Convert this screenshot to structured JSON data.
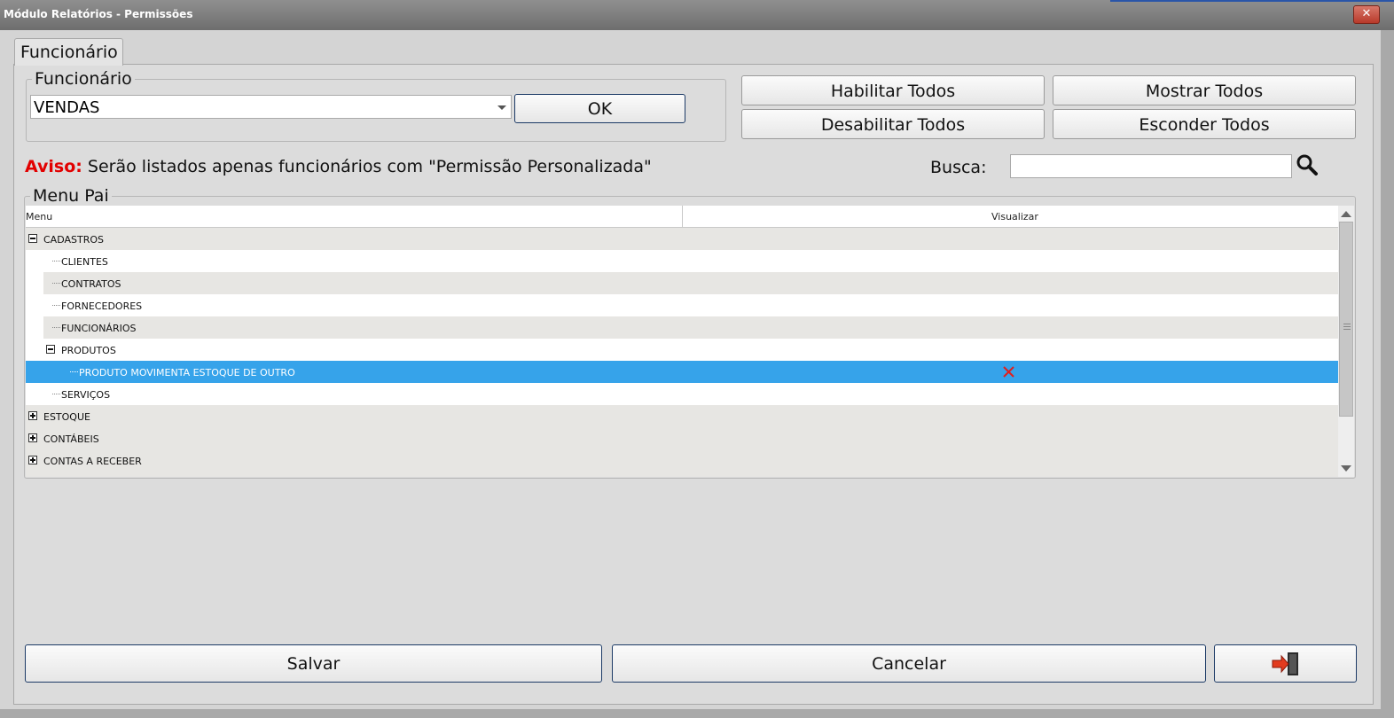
{
  "window": {
    "title": "Módulo Relatórios - Permissões",
    "close_label": "✕"
  },
  "tab": {
    "label": "Funcionário"
  },
  "funcionario": {
    "legend": "Funcionário",
    "selected": "VENDAS",
    "ok_label": "OK"
  },
  "actions": {
    "habilitar_todos": "Habilitar Todos",
    "mostrar_todos": "Mostrar Todos",
    "desabilitar_todos": "Desabilitar Todos",
    "esconder_todos": "Esconder Todos"
  },
  "warning": {
    "prefix": "Aviso:",
    "text": " Serão listados apenas funcionários com \"Permissão Personalizada\""
  },
  "search": {
    "label": "Busca:",
    "value": ""
  },
  "menu_pai": {
    "legend": "Menu Pai",
    "columns": [
      "Menu",
      "Visualizar"
    ],
    "rows": [
      {
        "label": "CADASTROS",
        "level": 0,
        "expander": "minus",
        "visualizar": ""
      },
      {
        "label": "CLIENTES",
        "level": 1,
        "expander": "",
        "visualizar": ""
      },
      {
        "label": "CONTRATOS",
        "level": 1,
        "expander": "",
        "visualizar": ""
      },
      {
        "label": "FORNECEDORES",
        "level": 1,
        "expander": "",
        "visualizar": ""
      },
      {
        "label": "FUNCIONÁRIOS",
        "level": 1,
        "expander": "",
        "visualizar": ""
      },
      {
        "label": "PRODUTOS",
        "level": 1,
        "expander": "minus",
        "visualizar": ""
      },
      {
        "label": "PRODUTO MOVIMENTA ESTOQUE DE OUTRO",
        "level": 2,
        "expander": "",
        "visualizar": "x-icon",
        "selected": true
      },
      {
        "label": "SERVIÇOS",
        "level": 1,
        "expander": "",
        "visualizar": ""
      },
      {
        "label": "ESTOQUE",
        "level": 0,
        "expander": "plus",
        "visualizar": ""
      },
      {
        "label": "CONTÁBEIS",
        "level": 0,
        "expander": "plus",
        "visualizar": ""
      },
      {
        "label": "CONTAS A RECEBER",
        "level": 0,
        "expander": "plus",
        "visualizar": ""
      }
    ]
  },
  "footer": {
    "salvar": "Salvar",
    "cancelar": "Cancelar",
    "exit_icon": "exit-door-icon"
  },
  "colors": {
    "selection": "#36a3ea",
    "warning": "#e20000",
    "x_mark": "#e0201e"
  }
}
